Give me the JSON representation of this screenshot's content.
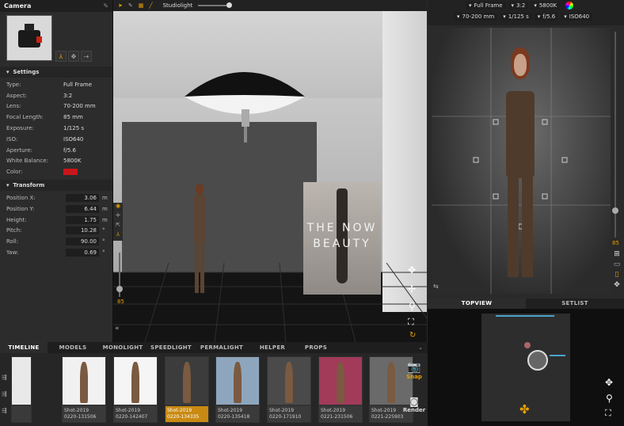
{
  "camera_panel": {
    "title": "Camera",
    "settings_title": "Settings",
    "settings": [
      {
        "key": "Type:",
        "value": "Full Frame"
      },
      {
        "key": "Aspect:",
        "value": "3:2"
      },
      {
        "key": "Lens:",
        "value": "70-200 mm"
      },
      {
        "key": "Focal Length:",
        "value": "85 mm"
      },
      {
        "key": "Exposure:",
        "value": "1/125 s"
      },
      {
        "key": "ISO:",
        "value": "ISO640"
      },
      {
        "key": "Aperture:",
        "value": "f/5.6"
      },
      {
        "key": "White Balance:",
        "value": "5800K"
      },
      {
        "key": "Color:",
        "value": ""
      }
    ],
    "color_value": "#c8151b",
    "transform_title": "Transform",
    "transform": [
      {
        "key": "Position X:",
        "value": "3.06",
        "unit": "m"
      },
      {
        "key": "Position Y:",
        "value": "6.44",
        "unit": "m"
      },
      {
        "key": "Height:",
        "value": "1.75",
        "unit": "m"
      },
      {
        "key": "Pitch:",
        "value": "10.28",
        "unit": "°"
      },
      {
        "key": "Roll:",
        "value": "90.00",
        "unit": "°"
      },
      {
        "key": "Yaw:",
        "value": "0.69",
        "unit": "°"
      }
    ]
  },
  "viewport": {
    "preset_label": "Studiolight",
    "poster_line1": "THE NOW",
    "poster_line2": "BEAUTY",
    "side_value": "85"
  },
  "preview_toolbar": {
    "type": "Full Frame",
    "aspect": "3:2",
    "wb": "5800K",
    "lens": "70-200 mm",
    "exposure": "1/125 s",
    "aperture": "f/5.6",
    "iso": "ISO640",
    "side_value": "85"
  },
  "right_tabs": [
    "TOPVIEW",
    "SETLIST"
  ],
  "bottom_tabs": [
    "TIMELINE",
    "MODELS",
    "MONOLIGHT",
    "SPEEDLIGHT",
    "PERMALIGHT",
    "HELPER",
    "PROPS"
  ],
  "shots": [
    {
      "line1": "",
      "line2": "",
      "color": "#e9e9e9"
    },
    {
      "line1": "Shot-2019",
      "line2": "0220-131506",
      "color": "#f1f1f1"
    },
    {
      "line1": "Shot-2019",
      "line2": "0220-142407",
      "color": "#f5f5f5"
    },
    {
      "line1": "Shot-2019",
      "line2": "0220-134335",
      "color": "#3c3c3c"
    },
    {
      "line1": "Shot-2019",
      "line2": "0220-135418",
      "color": "#8ea6bd"
    },
    {
      "line1": "Shot-2019",
      "line2": "0220-171910",
      "color": "#4a4a4a"
    },
    {
      "line1": "Shot-2019",
      "line2": "0221-231506",
      "color": "#a23a5a"
    },
    {
      "line1": "Shot-2019",
      "line2": "0221-225903",
      "color": "#6a6a6a"
    }
  ],
  "snap_label": "Snap",
  "render_label": "Render"
}
